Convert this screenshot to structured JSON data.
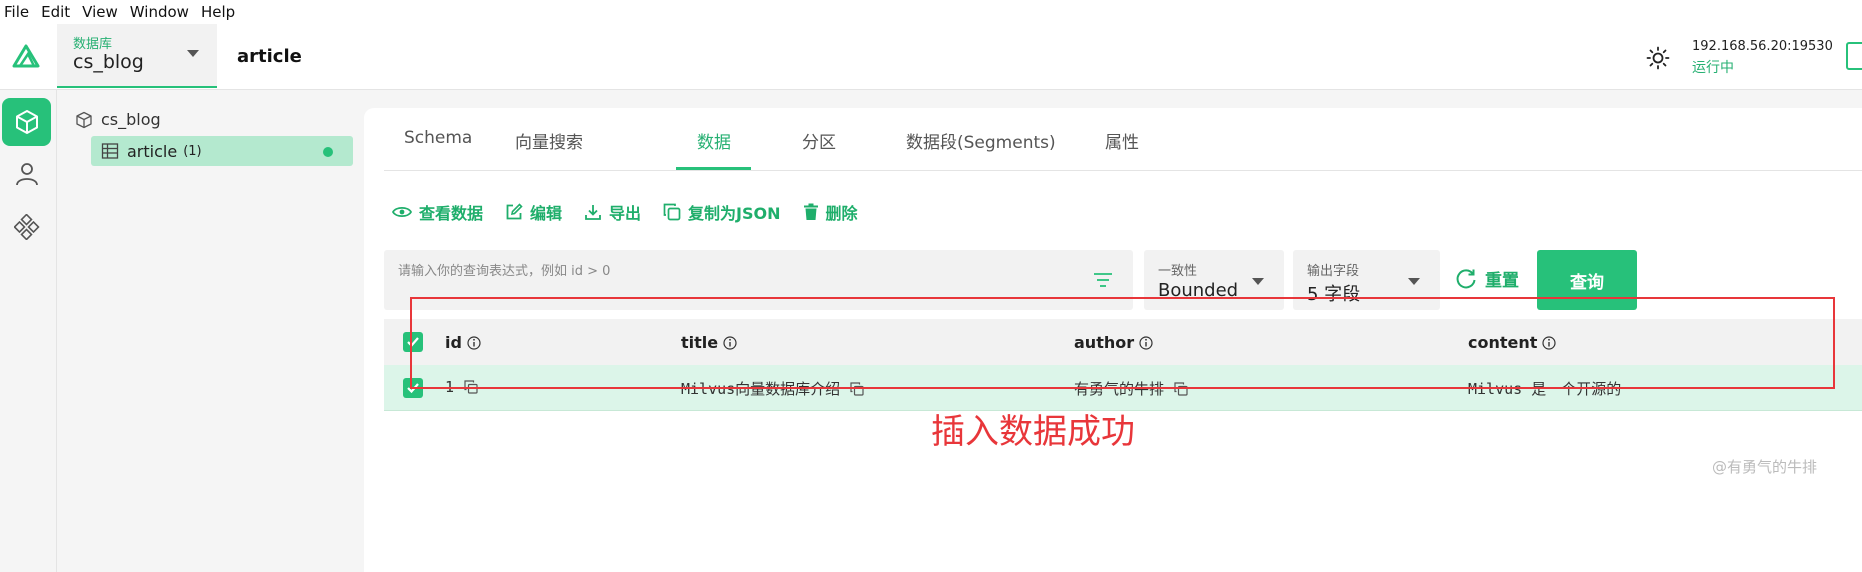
{
  "menu": [
    "File",
    "Edit",
    "Window",
    "Help",
    "View"
  ],
  "menu_order": [
    "File",
    "Edit",
    "View",
    "Window",
    "Help"
  ],
  "header": {
    "db_label": "数据库",
    "db_value": "cs_blog",
    "collection_title": "article",
    "connection_address": "192.168.56.20:19530",
    "connection_status": "运行中"
  },
  "rail": {
    "items": [
      "collections-icon",
      "user-icon",
      "plugins-icon"
    ]
  },
  "tree": {
    "database": "cs_blog",
    "collection": "article",
    "collection_count": "(1)"
  },
  "tabs": [
    "Schema",
    "向量搜索",
    "数据",
    "分区",
    "数据段(Segments)",
    "属性"
  ],
  "active_tab": "数据",
  "toolbar": {
    "view": "查看数据",
    "edit": "编辑",
    "export": "导出",
    "copy_json": "复制为JSON",
    "delete": "删除"
  },
  "query": {
    "placeholder": "请输入你的查询表达式，例如 id > 0",
    "consistency_label": "一致性",
    "consistency_value": "Bounded",
    "output_label": "输出字段",
    "output_value": "5 字段",
    "reset": "重置",
    "submit": "查询"
  },
  "table": {
    "columns": [
      "id",
      "title",
      "author",
      "content"
    ],
    "rows": [
      {
        "id": "1",
        "title": "Milvus向量数据库介绍",
        "author": "有勇气的牛排",
        "content": "Milvus 是一个开源的"
      }
    ]
  },
  "annotation": "插入数据成功",
  "watermark": "@有勇气的牛排",
  "colors": {
    "accent": "#27c17a",
    "annotation": "#e8363a"
  }
}
